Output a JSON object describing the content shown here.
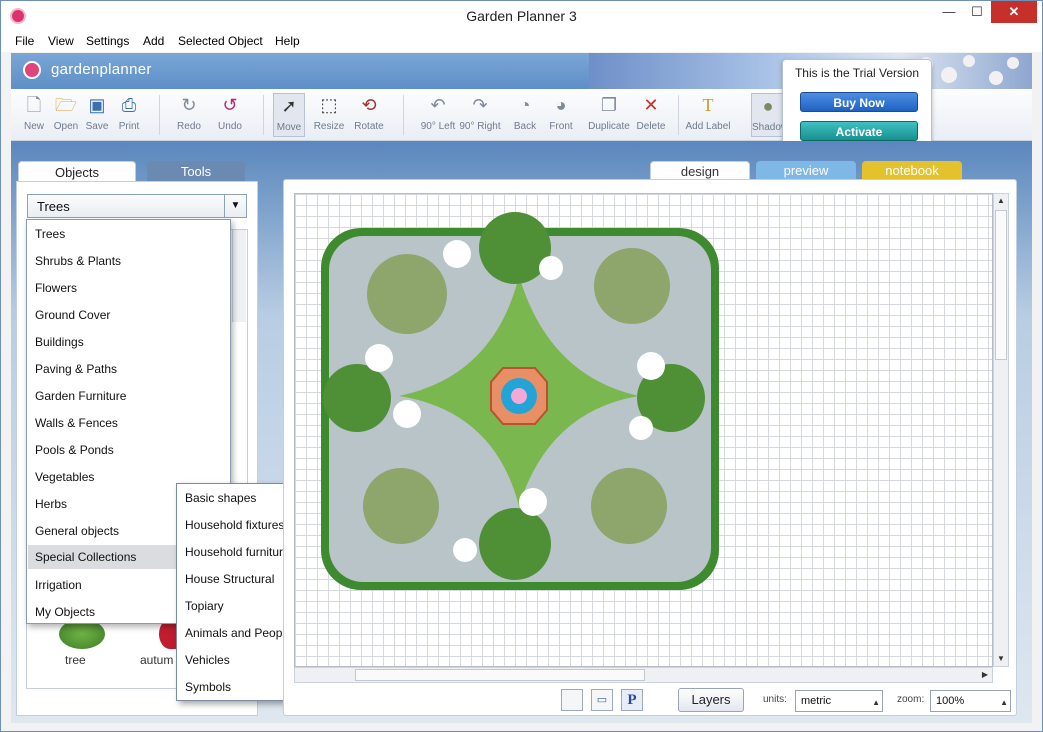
{
  "window": {
    "title": "Garden Planner 3",
    "min": "—",
    "max": "☐",
    "close": "✕"
  },
  "menu": [
    "File",
    "View",
    "Settings",
    "Add",
    "Selected Object",
    "Help"
  ],
  "brand": {
    "name": "gardenplanner"
  },
  "toolbar": {
    "new": "New",
    "open": "Open",
    "save": "Save",
    "print": "Print",
    "redo": "Redo",
    "undo": "Undo",
    "move": "Move",
    "resize": "Resize",
    "rotate": "Rotate",
    "left90": "90° Left",
    "right90": "90° Right",
    "back": "Back",
    "front": "Front",
    "duplicate": "Duplicate",
    "delete": "Delete",
    "add_label": "Add Label",
    "shadow": "Shadow"
  },
  "trial": {
    "title": "This is the Trial Version",
    "buy": "Buy Now",
    "activate": "Activate"
  },
  "side_tabs": {
    "objects": "Objects",
    "tools": "Tools"
  },
  "category": {
    "selected": "Trees"
  },
  "dropdown": [
    "Trees",
    "Shrubs & Plants",
    "Flowers",
    "Ground Cover",
    "Buildings",
    "Paving & Paths",
    "Garden Furniture",
    "Walls & Fences",
    "Pools & Ponds",
    "Vegetables",
    "Herbs",
    "General objects",
    "Special Collections",
    "Irrigation",
    "My Objects"
  ],
  "highlighted_item": "Special Collections",
  "submenu": [
    "Basic shapes",
    "Household fixtures",
    "Household furniture",
    "House Structural",
    "Topiary",
    "Animals and People",
    "Vehicles",
    "Symbols"
  ],
  "objects": {
    "tree": "tree",
    "autumn": "autum"
  },
  "view_tabs": {
    "design": "design",
    "preview": "preview",
    "notebook": "notebook"
  },
  "bottom": {
    "layers": "Layers",
    "units_label": "units:",
    "units_value": "metric",
    "zoom_label": "zoom:",
    "zoom_value": "100%"
  },
  "colors": {
    "accent_blue": "#1f62c4",
    "activate_teal": "#17918f",
    "notebook_yellow": "#e4c22e",
    "preview_blue": "#7fb8e6",
    "lawn_green": "#6aa84f"
  }
}
